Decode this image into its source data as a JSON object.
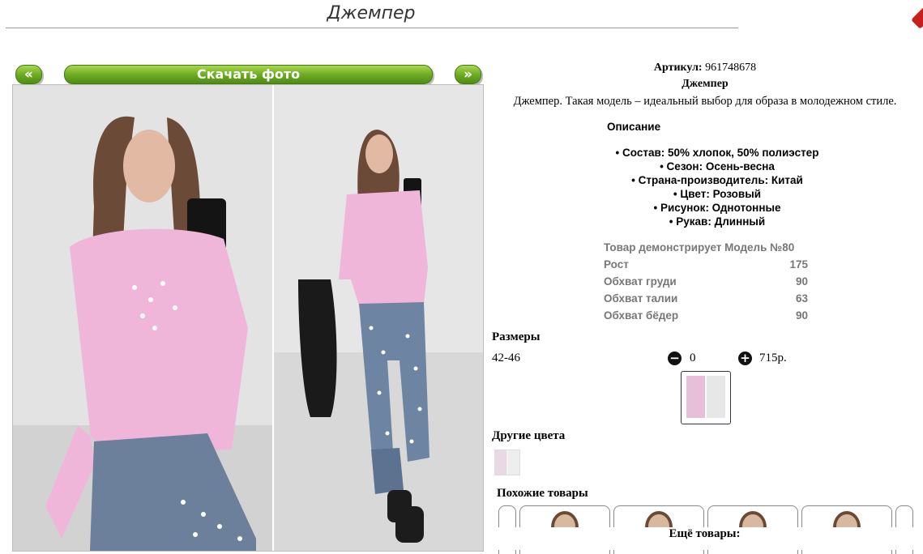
{
  "page": {
    "title": "Джемпер"
  },
  "gallery": {
    "prev_label": "«",
    "download_label": "Скачать фото",
    "next_label": "»"
  },
  "product": {
    "article_label": "Артикул:",
    "article_value": "961748678",
    "name": "Джемпер",
    "description": "Джемпер. Такая модель – идеальный выбор для образа в молодежном стиле.",
    "description_heading": "Описание",
    "properties": [
      "• Состав: 50% хлопок, 50% полиэстер",
      "• Сезон: Осень-весна",
      "• Страна-производитель: Китай",
      "• Цвет: Розовый",
      "• Рисунок: Однотонные",
      "• Рукав: Длинный"
    ],
    "model": {
      "heading": "Товар демонстрирует Модель №80",
      "rows": [
        {
          "label": "Рост",
          "value": "175"
        },
        {
          "label": "Обхват груди",
          "value": "90"
        },
        {
          "label": "Обхват талии",
          "value": "63"
        },
        {
          "label": "Обхват бёдер",
          "value": "90"
        }
      ]
    }
  },
  "sizes": {
    "label": "Размеры",
    "rows": [
      {
        "size": "42-46",
        "quantity": "0",
        "price": "715р."
      }
    ],
    "minus_icon": "−",
    "plus_icon": "+"
  },
  "other_colors": {
    "label": "Другие цвета"
  },
  "similar": {
    "label": "Похожие товары"
  },
  "more": {
    "label": "Ещё товары:"
  },
  "colors": {
    "accent_green": "#6aa823",
    "close_red": "#c81e1e"
  }
}
